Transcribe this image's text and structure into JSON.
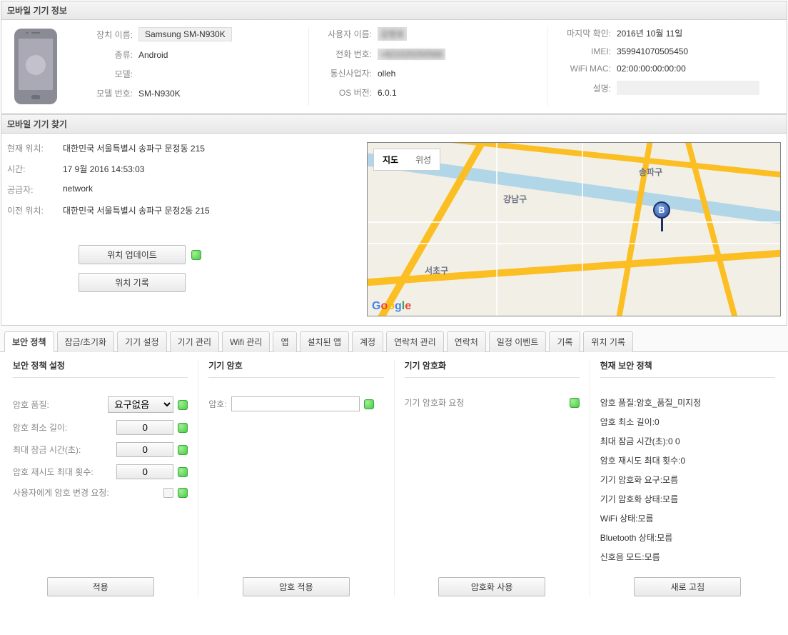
{
  "deviceInfo": {
    "header": "모바일 기기 정보",
    "labels": {
      "deviceName": "장치 이름:",
      "type": "종류:",
      "model": "모델:",
      "modelNo": "모델 번호:",
      "userName": "사용자 이름:",
      "phone": "전화 번호:",
      "carrier": "통신사업자:",
      "osver": "OS 버전:",
      "lastCheck": "마지막 확인:",
      "imei": "IMEI:",
      "wifiMac": "WiFi MAC:",
      "desc": "설명:"
    },
    "values": {
      "deviceName": "Samsung SM-N930K",
      "type": "Android",
      "model": "",
      "modelNo": "SM-N930K",
      "userName": "김영호",
      "phone": "+821020250566",
      "carrier": "olleh",
      "osver": "6.0.1",
      "lastCheck": "2016년 10월 11일",
      "imei": "359941070505450",
      "wifiMac": "02:00:00:00:00:00",
      "desc": ""
    }
  },
  "locate": {
    "header": "모바일 기기 찾기",
    "labels": {
      "curLoc": "현재 위치:",
      "time": "시간:",
      "provider": "공급자:",
      "prevLoc": "이전 위치:"
    },
    "values": {
      "curLoc": "대한민국 서울특별시 송파구 문정동 215",
      "time": "17 9월 2016 14:53:03",
      "provider": "network",
      "prevLoc": "대한민국 서울특별시 송파구 문정2동 215"
    },
    "buttons": {
      "update": "위치 업데이트",
      "history": "위치 기록"
    },
    "map": {
      "tabMap": "지도",
      "tabSat": "위성",
      "district1": "송파구",
      "district2": "강남구",
      "district3": "서초구",
      "pin": "B",
      "logo": "Google"
    }
  },
  "tabs": [
    "보안 정책",
    "잠금/초기화",
    "기기 설정",
    "기기 관리",
    "Wifi 관리",
    "앱",
    "설치된 앱",
    "계정",
    "연락처 관리",
    "연락처",
    "일정 이벤트",
    "기록",
    "위치 기록"
  ],
  "policy": {
    "col1": {
      "title": "보안 정책 설정",
      "rows": {
        "pwQuality": "암호 품질:",
        "pwQualityVal": "요구없음",
        "minLen": "암호 최소 길이:",
        "minLenVal": "0",
        "maxLock": "최대 잠금 시간(초):",
        "maxLockVal": "0",
        "maxRetry": "암호 재시도 최대 횟수:",
        "maxRetryVal": "0",
        "reqChange": "사용자에게 암호 변경 요청:"
      },
      "button": "적용"
    },
    "col2": {
      "title": "기기 암호",
      "pwLabel": "암호:",
      "button": "암호 적용"
    },
    "col3": {
      "title": "기기 암호화",
      "reqEnc": "기기 암호화 요청",
      "button": "암호화 사용"
    },
    "col4": {
      "title": "현재 보안 정책",
      "lines": [
        "암호 품질:암호_품질_미지정",
        "암호 최소 길이:0",
        "최대 잠금 시간(초):0 0",
        "암호 재시도 최대 횟수:0",
        "기기 암호화 요구:모름",
        "기기 암호화 상태:모름",
        "WiFi 상태:모름",
        "Bluetooth 상태:모름",
        "신호음 모드:모름"
      ],
      "button": "새로 고침"
    }
  }
}
